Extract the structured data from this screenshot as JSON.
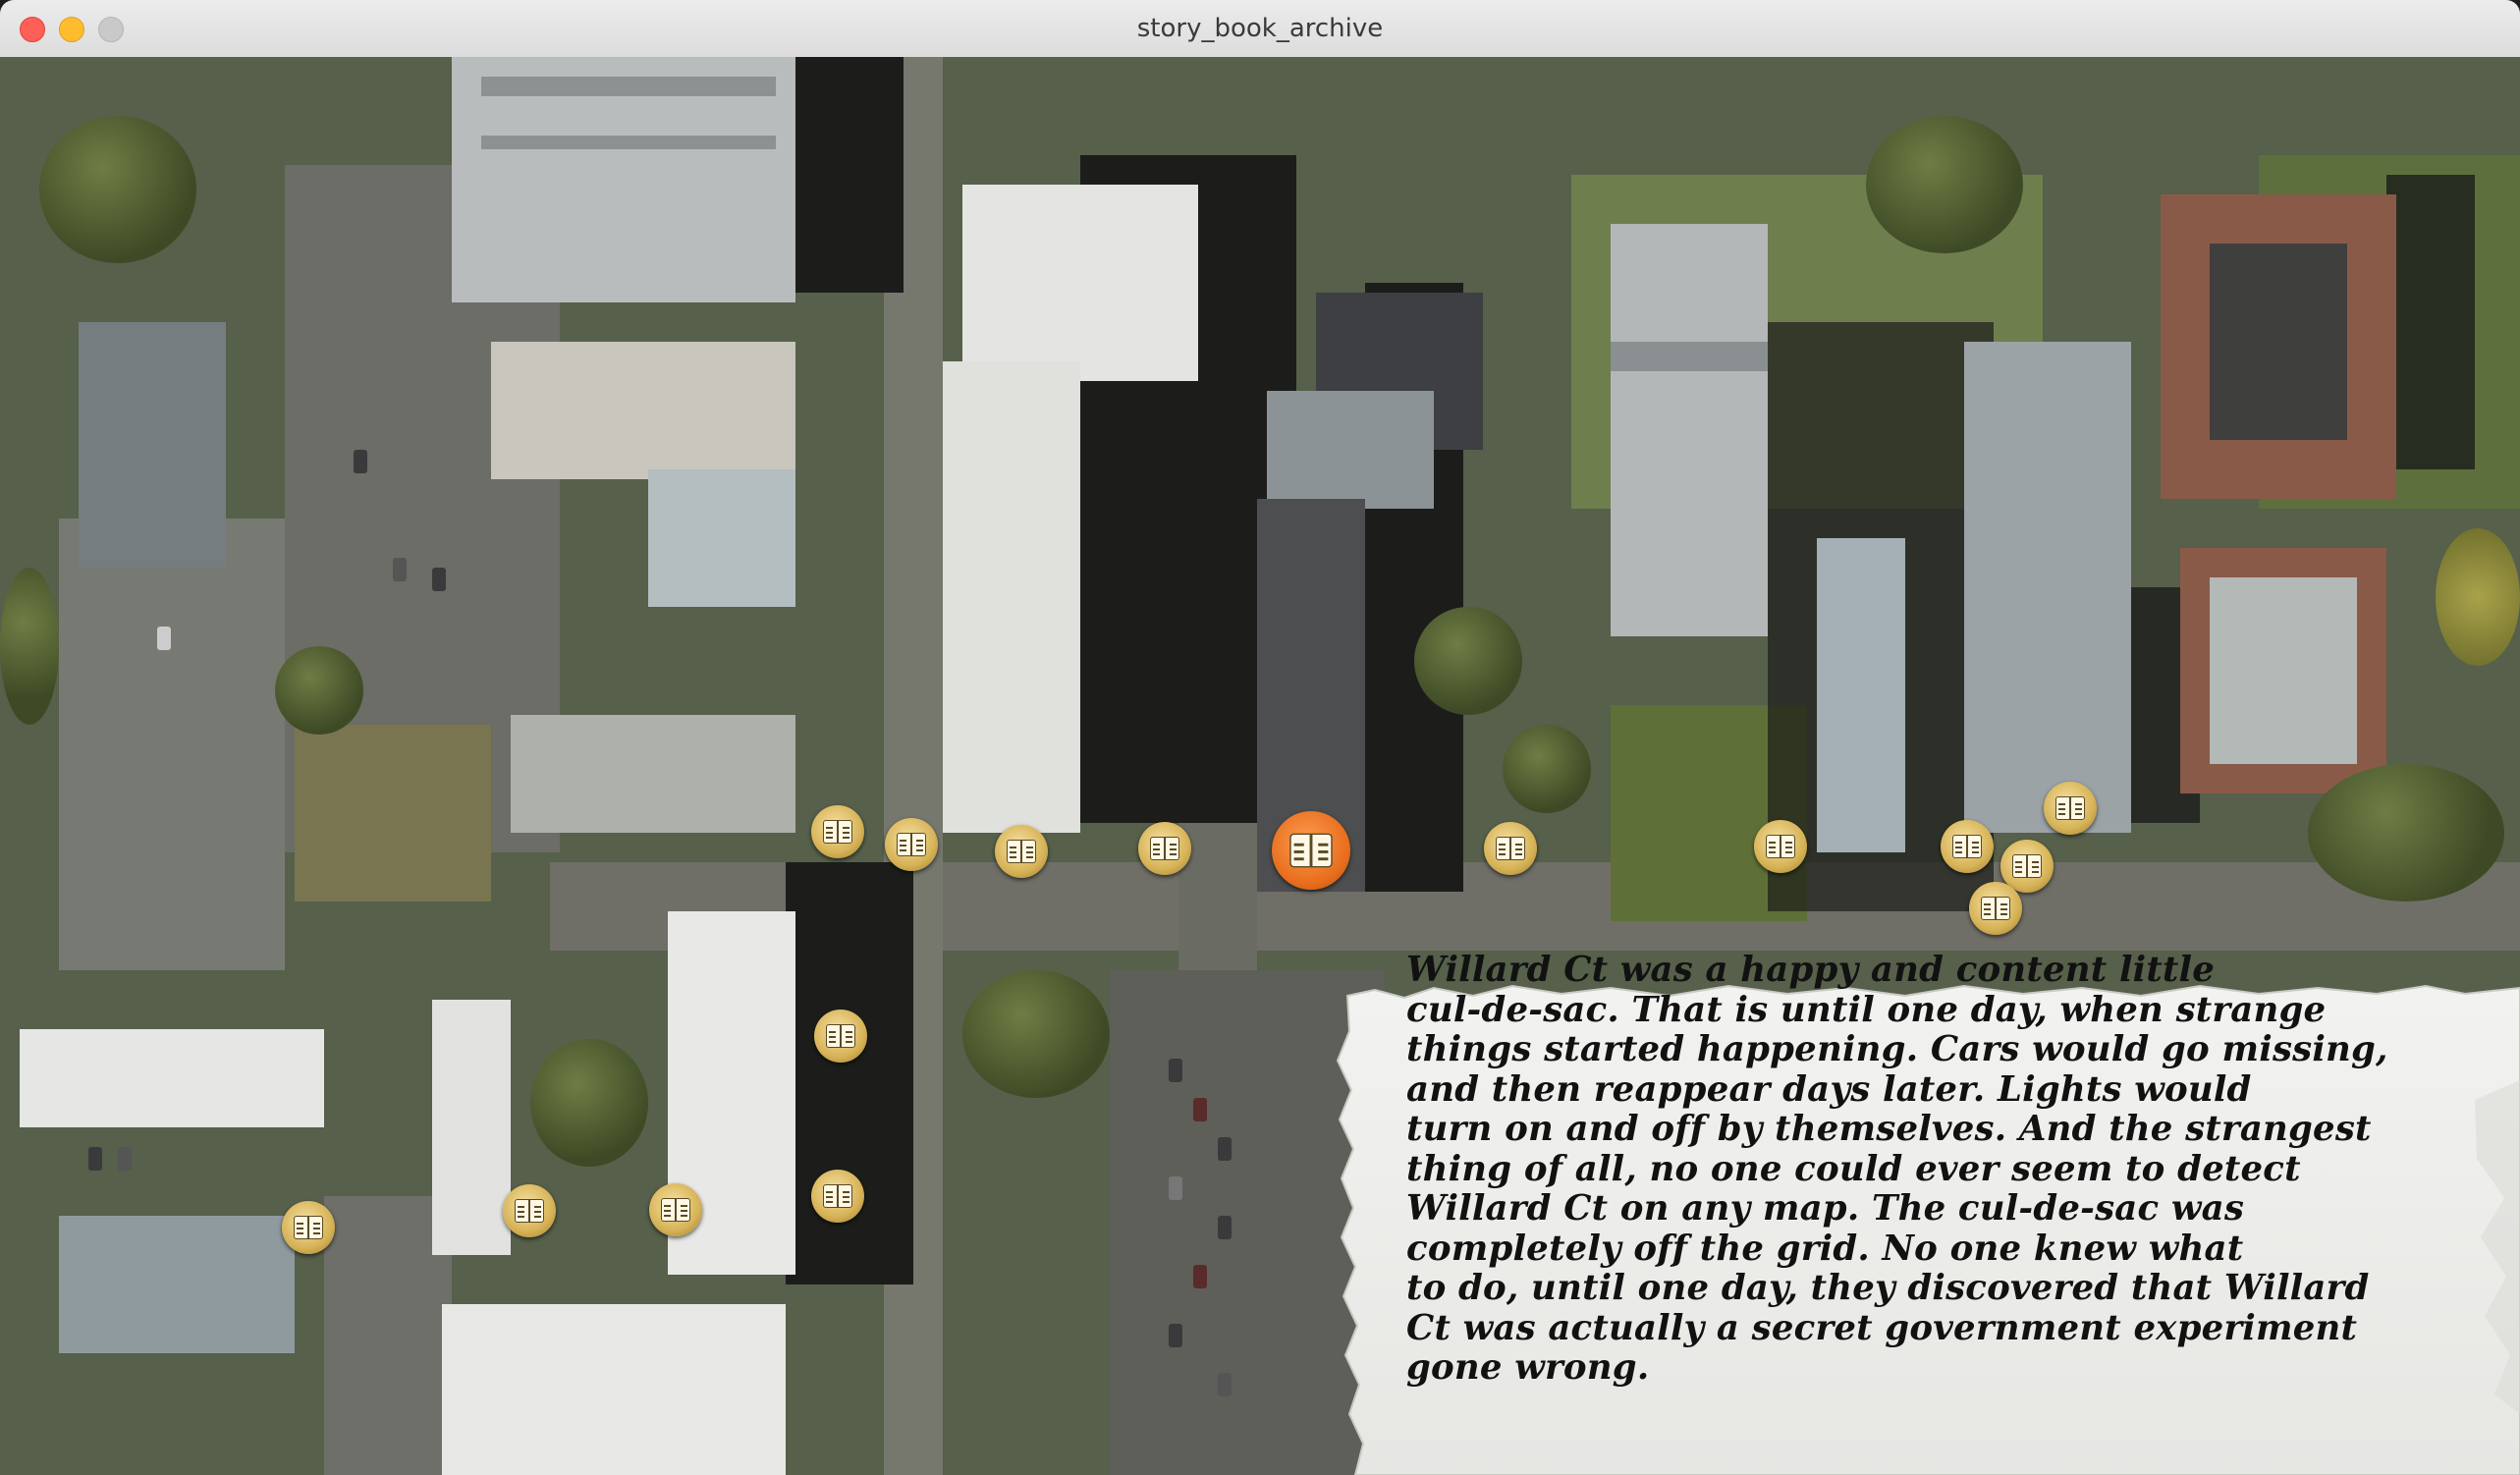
{
  "window": {
    "title": "story_book_archive"
  },
  "map": {
    "type": "satellite",
    "markers": [
      {
        "icon": "book-icon",
        "active": false
      },
      {
        "icon": "book-icon",
        "active": false
      },
      {
        "icon": "book-icon",
        "active": false
      },
      {
        "icon": "book-icon",
        "active": false
      },
      {
        "icon": "book-icon",
        "active": true
      },
      {
        "icon": "book-icon",
        "active": false
      },
      {
        "icon": "book-icon",
        "active": false
      },
      {
        "icon": "book-icon",
        "active": false
      },
      {
        "icon": "book-icon",
        "active": false
      },
      {
        "icon": "book-icon",
        "active": false
      },
      {
        "icon": "book-icon",
        "active": false
      },
      {
        "icon": "book-icon",
        "active": false
      },
      {
        "icon": "book-icon",
        "active": false
      },
      {
        "icon": "book-icon",
        "active": false
      },
      {
        "icon": "book-icon",
        "active": false
      },
      {
        "icon": "book-icon",
        "active": false
      }
    ]
  },
  "story": {
    "lines": [
      "Willard Ct was a happy and content little",
      "cul-de-sac. That is until one day, when strange",
      "things started happening. Cars would go missing,",
      "and then reappear days later. Lights would",
      "turn on and off by themselves. And the strangest",
      "thing of all, no one could ever seem to detect",
      "Willard Ct on any map. The cul-de-sac was",
      "completely off the grid. No one knew what",
      "to do, until one day, they discovered that Willard",
      "Ct was actually a secret government experiment",
      "gone wrong."
    ]
  },
  "colors": {
    "marker": "#d7b357",
    "marker_active": "#e76d1c",
    "parchment": "#efefed"
  }
}
